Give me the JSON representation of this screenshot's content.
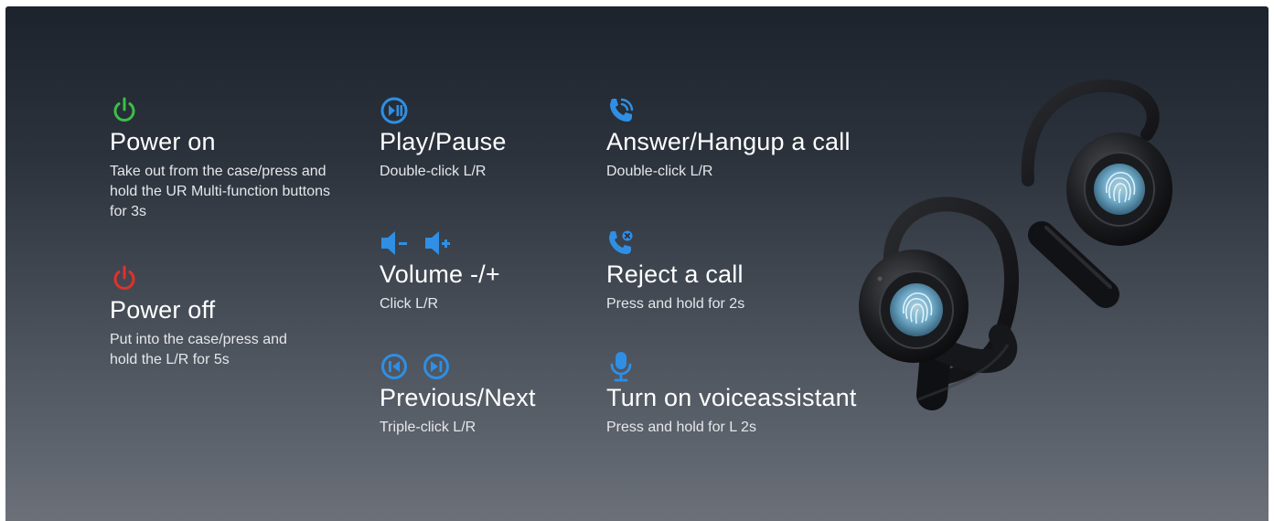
{
  "features": {
    "power_on": {
      "icon": "power-on-icon",
      "color": "#3cbf47",
      "title": "Power on",
      "desc": "Take out from the case/press and hold the UR Multi-function buttons for 3s"
    },
    "power_off": {
      "icon": "power-off-icon",
      "color": "#e0312b",
      "title": "Power off",
      "desc": "Put into the case/press and hold the L/R for 5s"
    },
    "play_pause": {
      "icon": "play-pause-icon",
      "color": "#2f8fe4",
      "title": "Play/Pause",
      "desc": "Double-click L/R"
    },
    "volume": {
      "icons": [
        "volume-down-icon",
        "volume-up-icon"
      ],
      "color": "#2f8fe4",
      "title": "Volume -/+",
      "desc": "Click L/R"
    },
    "prev_next": {
      "icons": [
        "previous-track-icon",
        "next-track-icon"
      ],
      "color": "#2f8fe4",
      "title": "Previous/Next",
      "desc": "Triple-click L/R"
    },
    "answer_call": {
      "icon": "phone-call-icon",
      "color": "#2f8fe4",
      "title": "Answer/Hangup a call",
      "desc": "Double-click L/R"
    },
    "reject_call": {
      "icon": "phone-reject-icon",
      "color": "#2f8fe4",
      "title": "Reject a call",
      "desc": "Press and hold for 2s"
    },
    "voice_assistant": {
      "icon": "microphone-icon",
      "color": "#2f8fe4",
      "title": "Turn on voiceassistant",
      "desc": "Press and hold for L 2s"
    }
  },
  "product_image": {
    "icon": "earbuds-illustration"
  }
}
